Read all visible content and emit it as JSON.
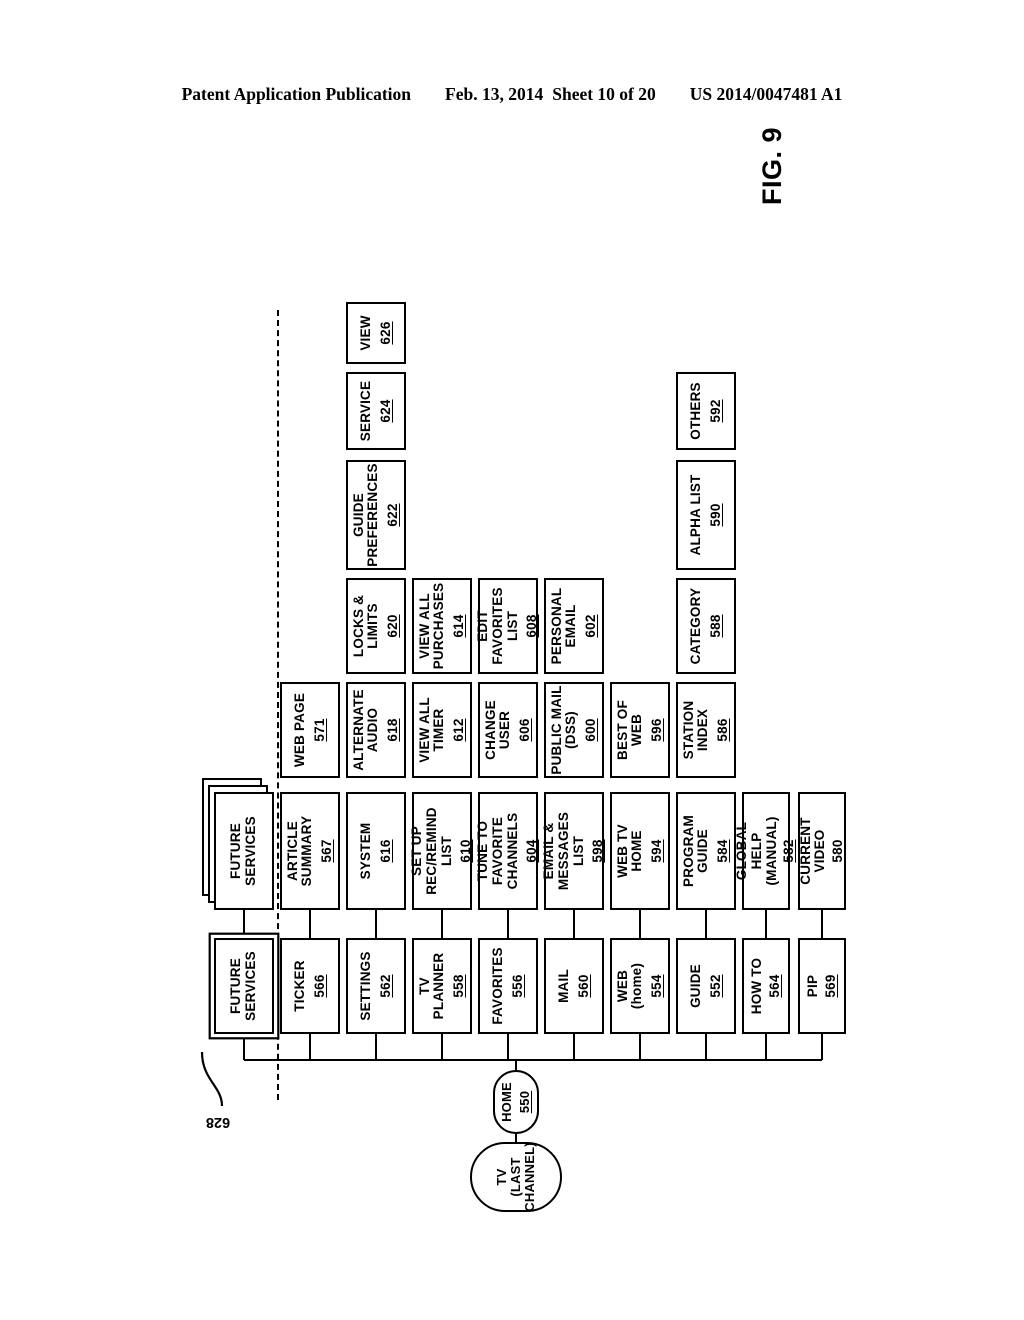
{
  "header": {
    "publication": "Patent Application Publication",
    "date": "Feb. 13, 2014",
    "sheet": "Sheet 10 of 20",
    "number": "US 2014/0047481 A1"
  },
  "figure": {
    "label": "FIG. 9"
  },
  "chart_data": {
    "type": "diagram",
    "title": "FIG. 9",
    "orientation": "rotated-90-ccw",
    "root": {
      "label": "TV\n(LAST CHANNEL)",
      "number": "",
      "shape": "rounded"
    },
    "home": {
      "label": "HOME",
      "number": "550",
      "shape": "rounded"
    },
    "annotations": [
      {
        "name": "ref-628",
        "text": "628",
        "target": "future-services-primary"
      },
      {
        "name": "section-divider",
        "text": "",
        "style": "dashed"
      }
    ],
    "rows": [
      {
        "id": "future-services",
        "level1": {
          "label": "FUTURE\nSERVICES",
          "number": "",
          "style": "double"
        },
        "children": [
          {
            "label": "FUTURE\nSERVICES",
            "number": "",
            "style": "stack"
          }
        ]
      },
      {
        "id": "ticker",
        "level1": {
          "label": "TICKER",
          "number": "566"
        },
        "children": [
          {
            "label": "ARTICLE\nSUMMARY",
            "number": "567"
          },
          {
            "label": "WEB PAGE",
            "number": "571"
          }
        ]
      },
      {
        "id": "settings",
        "level1": {
          "label": "SETTINGS",
          "number": "562"
        },
        "children": [
          {
            "label": "SYSTEM",
            "number": "616"
          },
          {
            "label": "ALTERNATE\nAUDIO",
            "number": "618"
          },
          {
            "label": "LOCKS &\nLIMITS",
            "number": "620"
          },
          {
            "label": "GUIDE\nPREFERENCES",
            "number": "622"
          },
          {
            "label": "SERVICE",
            "number": "624"
          },
          {
            "label": "VIEW",
            "number": "626"
          }
        ]
      },
      {
        "id": "tv-planner",
        "level1": {
          "label": "TV\nPLANNER",
          "number": "558"
        },
        "children": [
          {
            "label": "SET UP\nREC/REMIND\nLIST",
            "number": "610"
          },
          {
            "label": "VIEW ALL\nTIMER",
            "number": "612"
          },
          {
            "label": "VIEW ALL\nPURCHASES",
            "number": "614"
          }
        ]
      },
      {
        "id": "favorites",
        "level1": {
          "label": "FAVORITES",
          "number": "556"
        },
        "children": [
          {
            "label": "TUNE TO\nFAVORITE\nCHANNELS",
            "number": "604"
          },
          {
            "label": "CHANGE\nUSER",
            "number": "606"
          },
          {
            "label": "EDIT\nFAVORITES\nLIST",
            "number": "608"
          }
        ]
      },
      {
        "id": "mail",
        "level1": {
          "label": "MAIL",
          "number": "560"
        },
        "children": [
          {
            "label": "EMAIL &\nMESSAGES\nLIST",
            "number": "598"
          },
          {
            "label": "PUBLIC MAIL\n(DSS)",
            "number": "600"
          },
          {
            "label": "PERSONAL\nEMAIL",
            "number": "602"
          }
        ]
      },
      {
        "id": "web",
        "level1": {
          "label": "WEB\n(home)",
          "number": "554"
        },
        "children": [
          {
            "label": "WEB TV\nHOME",
            "number": "594"
          },
          {
            "label": "BEST OF\nWEB",
            "number": "596"
          }
        ]
      },
      {
        "id": "guide",
        "level1": {
          "label": "GUIDE",
          "number": "552"
        },
        "children": [
          {
            "label": "PROGRAM\nGUIDE",
            "number": "584"
          },
          {
            "label": "STATION\nINDEX",
            "number": "586"
          },
          {
            "label": "CATEGORY",
            "number": "588"
          },
          {
            "label": "ALPHA LIST",
            "number": "590"
          },
          {
            "label": "OTHERS",
            "number": "592"
          }
        ]
      },
      {
        "id": "how-to",
        "level1": {
          "label": "HOW TO",
          "number": "564"
        },
        "children": [
          {
            "label": "GLOBAL\nHELP\n(MANUAL)",
            "number": "582"
          }
        ]
      },
      {
        "id": "pip",
        "level1": {
          "label": "PIP",
          "number": "569"
        },
        "children": [
          {
            "label": "CURRENT\nVIDEO",
            "number": "580"
          }
        ]
      }
    ]
  }
}
